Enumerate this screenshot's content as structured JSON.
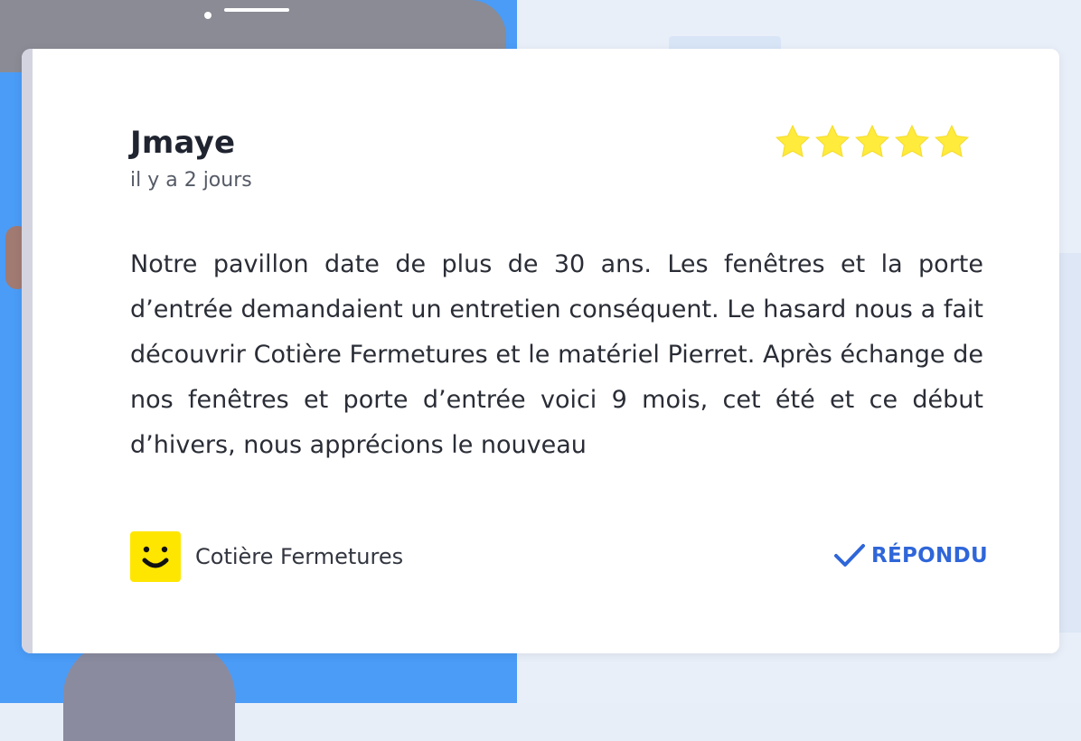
{
  "review": {
    "author": "Jmaye",
    "date": "il y a 2 jours",
    "rating": 5,
    "rating_max": 5,
    "text": "Notre pavillon date de plus de 30 ans. Les fenêtres et la porte d’entrée demandaient un entretien conséquent. Le hasard nous a fait découvrir Cotière Fermetures et le matériel Pierret. Après échange de nos fenêtres et porte d’entrée voici 9 mois, cet été et ce début d’hivers, nous apprécions le nouveau"
  },
  "business": {
    "name": "Cotière Fermetures",
    "logo_icon": "smiley-logo-icon",
    "logo_color": "#FFE600"
  },
  "status": {
    "label": "RÉPONDU",
    "icon": "check-icon",
    "color": "#2F66D9"
  },
  "colors": {
    "star": "#FFEB3B",
    "card_accent": "#D3D4E0",
    "background_blue": "#4A9CF7"
  }
}
